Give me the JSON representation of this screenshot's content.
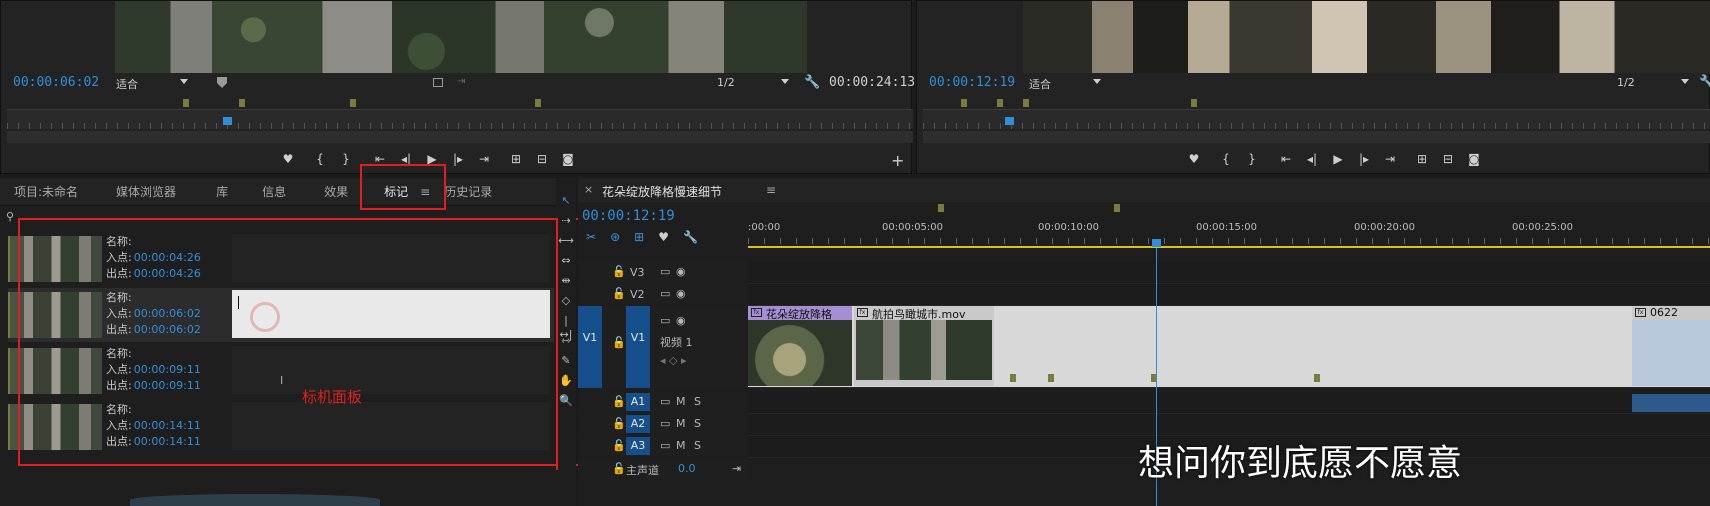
{
  "source_monitor": {
    "timecode": "00:00:06:02",
    "fit": "适合",
    "resolution": "1/2",
    "duration": "00:00:24:13"
  },
  "program_monitor": {
    "timecode": "00:00:12:19",
    "fit": "适合",
    "resolution": "1/2"
  },
  "panel_tabs": [
    "项目:未命名",
    "媒体浏览器",
    "库",
    "信息",
    "效果",
    "标记",
    "历史记录"
  ],
  "active_tab": "标记",
  "markers": [
    {
      "name_label": "名称:",
      "in_label": "入点:",
      "in": "00:00:04:26",
      "out_label": "出点:",
      "out": "00:00:04:26"
    },
    {
      "name_label": "名称:",
      "in_label": "入点:",
      "in": "00:00:06:02",
      "out_label": "出点:",
      "out": "00:00:06:02"
    },
    {
      "name_label": "名称:",
      "in_label": "入点:",
      "in": "00:00:09:11",
      "out_label": "出点:",
      "out": "00:00:09:11"
    },
    {
      "name_label": "名称:",
      "in_label": "入点:",
      "in": "00:00:14:11",
      "out_label": "出点:",
      "out": "00:00:14:11"
    }
  ],
  "annotation": "标机面板",
  "timeline": {
    "sequence_name": "花朵绽放降格慢速细节",
    "timecode": "00:00:12:19",
    "ruler": [
      ":00:00",
      "00:00:05:00",
      "00:00:10:00",
      "00:00:15:00",
      "00:00:20:00",
      "00:00:25:00"
    ],
    "video_tracks": [
      "V3",
      "V2",
      "V1"
    ],
    "v1_name": "视频 1",
    "source_patch_v": "V1",
    "audio_tracks": [
      "A1",
      "A2",
      "A3"
    ],
    "mute": "M",
    "solo": "S",
    "master_label": "主声道",
    "master_value": "0.0",
    "clips": [
      {
        "name": "花朵绽放降格"
      },
      {
        "name": "航拍鸟瞰城市.mov"
      },
      {
        "name": "0622"
      }
    ]
  },
  "subtitle": "想问你到底愿不愿意",
  "colors": {
    "accent_blue": "#2f8fd8",
    "marker_olive": "#7a7d3a",
    "highlight_red": "#e02020",
    "clip_purple": "#a58ed1"
  }
}
